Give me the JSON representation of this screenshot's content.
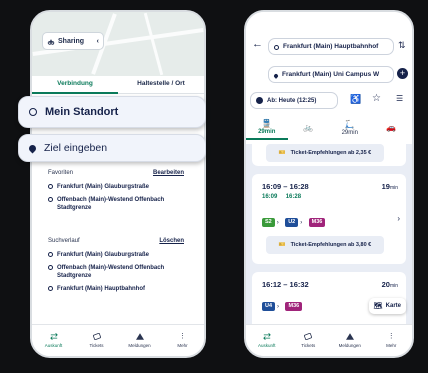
{
  "left_phone": {
    "sharing_label": "Sharing",
    "tabs": [
      {
        "label": "Verbindung"
      },
      {
        "label": "Haltestelle / Ort"
      }
    ],
    "origin": "Mein Standort",
    "destination_placeholder": "Ziel eingeben",
    "favorites": {
      "title": "Favoriten",
      "action": "Bearbeiten",
      "items": [
        "Frankfurt (Main) Glauburgstraße",
        "Offenbach (Main)-Westend Offenbach Stadtgrenze"
      ]
    },
    "history": {
      "title": "Suchverlauf",
      "action": "Löschen",
      "items": [
        "Frankfurt (Main) Glauburgstraße",
        "Offenbach (Main)-Westend Offenbach Stadtgrenze",
        "Frankfurt (Main) Hauptbahnhof"
      ]
    },
    "nav": [
      {
        "label": "Auskunft"
      },
      {
        "label": "Tickets"
      },
      {
        "label": "Meldungen"
      },
      {
        "label": "Mehr"
      }
    ]
  },
  "right_phone": {
    "from": "Frankfurt (Main) Hauptbahnhof",
    "to": "Frankfurt (Main) Uni Campus W",
    "time": "Ab: Heute (12:25)",
    "modes": [
      {
        "label": "29min"
      },
      {
        "label": ""
      },
      {
        "label": "29min"
      },
      {
        "label": ""
      }
    ],
    "ticket_top": "Ticket-Empfehlungen ab 2,35 €",
    "trip1": {
      "times": "16:09 – 16:28",
      "realtime_dep": "16:09",
      "realtime_arr": "16:28",
      "duration": "19",
      "unit": "min",
      "lines": [
        "S2",
        "U2",
        "M36"
      ],
      "ticket": "Ticket-Empfehlungen ab 3,80 €"
    },
    "trip2": {
      "times": "16:12 – 16:32",
      "duration": "20",
      "unit": "min",
      "lines": [
        "U4",
        "M36"
      ]
    },
    "map_button": "Karte",
    "nav": [
      {
        "label": "Auskunft"
      },
      {
        "label": "Tickets"
      },
      {
        "label": "Meldungen"
      },
      {
        "label": "Mehr"
      }
    ]
  },
  "colors": {
    "accent": "#0a7a5a",
    "navy": "#16224a",
    "s_bahn": "#3a9a3a",
    "u_bahn": "#1f4e99",
    "tram": "#a0247a"
  }
}
